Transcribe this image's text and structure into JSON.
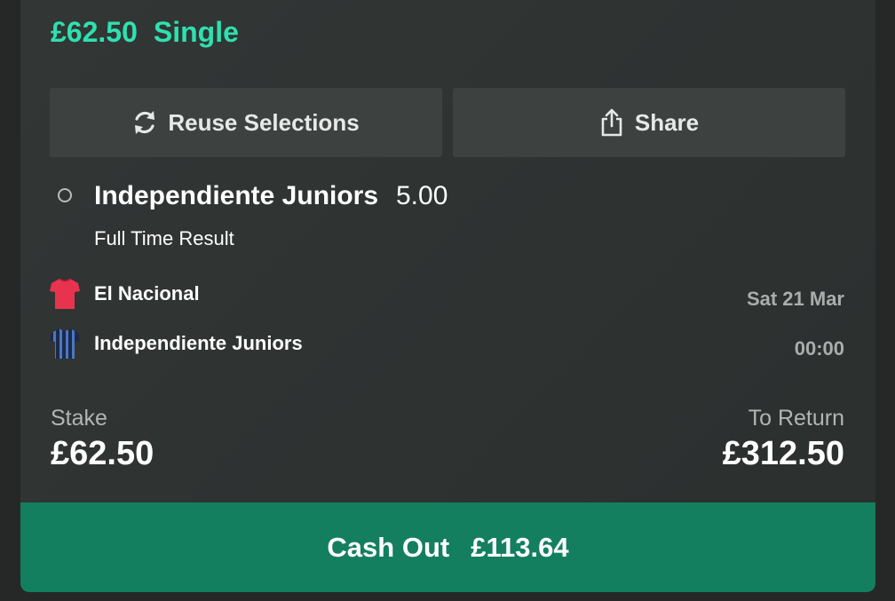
{
  "bet": {
    "stake_amount": "£62.50",
    "bet_type": "Single"
  },
  "actions": {
    "reuse_label": "Reuse Selections",
    "share_label": "Share"
  },
  "selection": {
    "name": "Independiente Juniors",
    "odds": "5.00",
    "market": "Full Time Result"
  },
  "event": {
    "home_team": "El Nacional",
    "away_team": "Independiente Juniors",
    "date": "Sat 21 Mar",
    "time": "00:00"
  },
  "summary": {
    "stake_label": "Stake",
    "stake_value": "£62.50",
    "return_label": "To Return",
    "return_value": "£312.50"
  },
  "cashout": {
    "label": "Cash Out",
    "value": "£113.64"
  },
  "colors": {
    "accent_green": "#2fe0b0",
    "cashout_bg": "#137f5f",
    "card_bg": "#2e3231",
    "home_kit": "#e8334f",
    "away_kit": "#1c2a4a"
  },
  "icons": {
    "reuse": "refresh-icon",
    "share": "share-icon",
    "home_kit": "shirt-icon",
    "away_kit": "shirt-icon"
  }
}
